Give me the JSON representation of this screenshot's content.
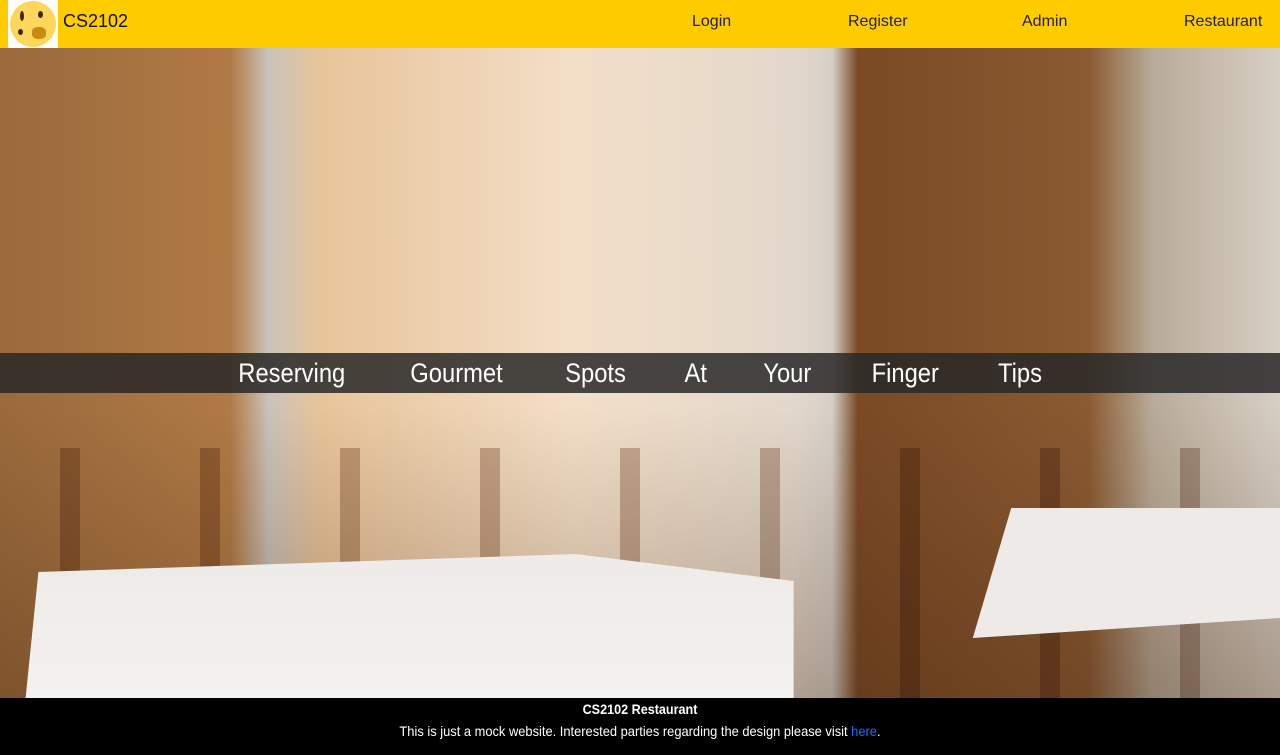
{
  "nav": {
    "brand": "CS2102",
    "links": [
      "Login",
      "Register",
      "Admin",
      "Restaurant"
    ]
  },
  "hero": {
    "tagline_words": [
      "Reserving",
      "Gourmet",
      "Spots",
      "At",
      "Your",
      "Finger",
      "Tips"
    ]
  },
  "footer": {
    "title": "CS2102 Restaurant",
    "text": "This is just a mock website. Interested parties regarding the design please visit ",
    "link": "here",
    "suffix": "."
  },
  "colors": {
    "nav": "#ffcc00",
    "footer": "#000000",
    "link": "#1a6dff"
  }
}
